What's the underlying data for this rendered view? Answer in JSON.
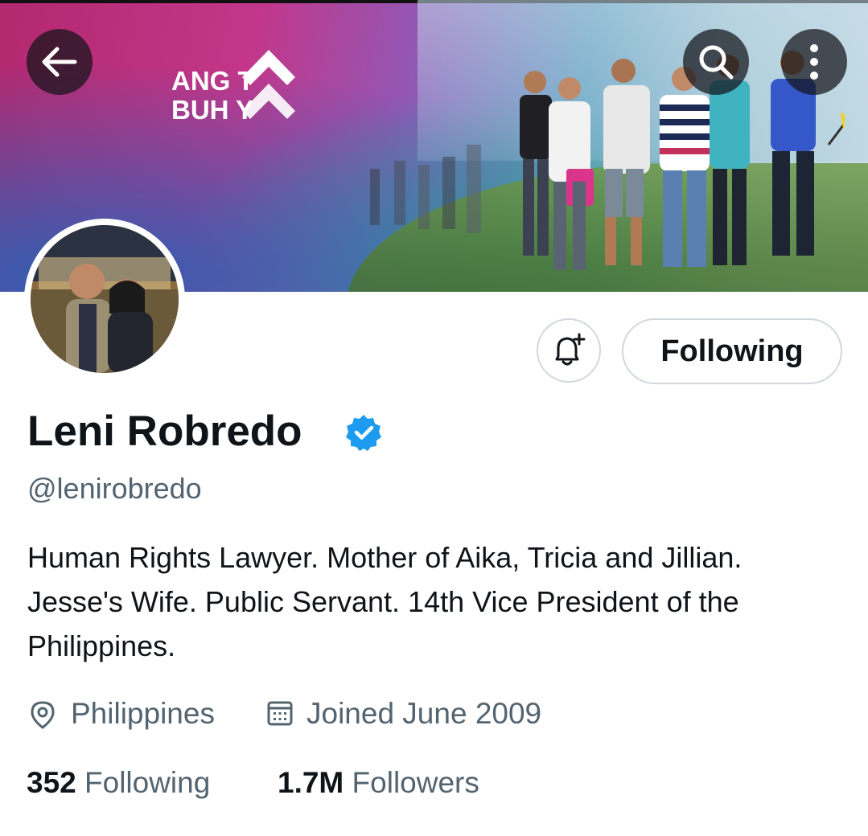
{
  "header": {
    "banner_logo_line1": "ANG  T",
    "banner_logo_line2": "BUH   Y",
    "back_icon": "arrow-left-icon",
    "search_icon": "search-icon",
    "more_icon": "more-vertical-icon"
  },
  "profile": {
    "name": "Leni Robredo",
    "verified": true,
    "handle": "@lenirobredo",
    "bio": "Human Rights Lawyer. Mother of Aika, Tricia and Jillian. Jesse's Wife. Public Servant. 14th Vice President of the Philippines.",
    "location": "Philippines",
    "joined": "Joined June 2009",
    "following_count": "352",
    "following_label": "Following",
    "followers_count": "1.7M",
    "followers_label": "Followers"
  },
  "actions": {
    "notify_icon": "bell-plus-icon",
    "follow_button_label": "Following"
  },
  "colors": {
    "text_primary": "#0f1419",
    "text_secondary": "#536471",
    "verified_blue": "#1d9bf0",
    "button_border": "#cfd9de"
  }
}
